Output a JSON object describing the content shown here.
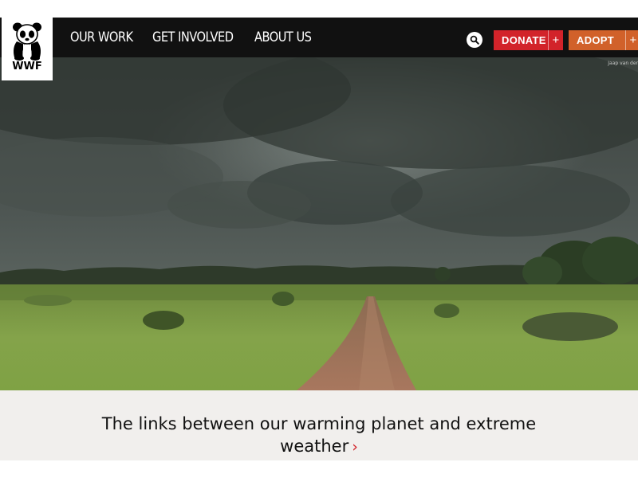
{
  "brand": {
    "logo_text": "WWF",
    "logo_icon": "panda-icon"
  },
  "nav": {
    "items": [
      {
        "label": "OUR WORK"
      },
      {
        "label": "GET INVOLVED"
      },
      {
        "label": "ABOUT US"
      }
    ],
    "search_icon": "search-icon",
    "donate_label": "DONATE",
    "adopt_label": "ADOPT",
    "plus_symbol": "+"
  },
  "hero": {
    "photo_credit": "Jaap van der",
    "scene": "stormy sky over savanna with dirt road"
  },
  "feature": {
    "headline": "The links between our warming planet and extreme weather",
    "arrow": "›"
  },
  "colors": {
    "nav_background": "#111111",
    "donate": "#d2232a",
    "adopt": "#d1612a",
    "caption_background": "#f1efed"
  }
}
